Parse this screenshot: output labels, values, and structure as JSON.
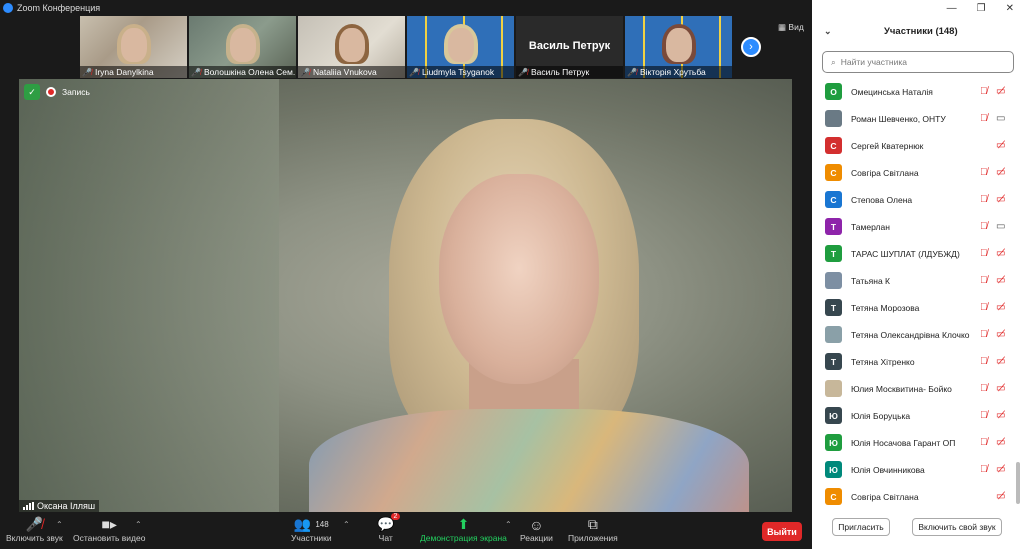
{
  "window": {
    "title": "Zoom Конференция"
  },
  "thumbnails": [
    {
      "name": "Iryna Danylkina",
      "muted": true
    },
    {
      "name": "Волошкіна Олена Сем...",
      "muted": true
    },
    {
      "name": "Nataliia Vnukova",
      "muted": true
    },
    {
      "name": "Liudmyla Tsyganok",
      "muted": true
    },
    {
      "name": "Василь Петрук",
      "muted": true,
      "display_text": "Василь Петрук"
    },
    {
      "name": "Вікторія Хрутьба",
      "muted": true
    }
  ],
  "view_label": "Вид",
  "recording": {
    "label": "Запись"
  },
  "main_video": {
    "speaker_name": "Оксана Ілляш"
  },
  "toolbar": {
    "unmute": "Включить звук",
    "stop_video": "Остановить видео",
    "participants": "Участники",
    "participants_count": "148",
    "chat": "Чат",
    "chat_badge": "2",
    "share": "Демонстрация экрана",
    "reactions": "Реакции",
    "apps": "Приложения",
    "leave": "Выйти"
  },
  "panel": {
    "title": "Участники (148)",
    "search_placeholder": "Найти участника",
    "participants": [
      {
        "initial": "О",
        "name": "Омецинська Наталія",
        "color": "#1f9d3f",
        "cam_on": false
      },
      {
        "initial": "",
        "name": "Роман Шевченко, ОНТУ",
        "color": "#6a7a85",
        "cam_on": true
      },
      {
        "initial": "С",
        "name": "Сергей Кватернюк",
        "color": "#d32f2f",
        "cam_on": false,
        "no_mic": true
      },
      {
        "initial": "С",
        "name": "Совгіра Світлана",
        "color": "#ef8c00",
        "cam_on": false
      },
      {
        "initial": "С",
        "name": "Степова Олена",
        "color": "#1976d2",
        "cam_on": false
      },
      {
        "initial": "Т",
        "name": "Тамерлан",
        "color": "#8e24aa",
        "cam_on": true
      },
      {
        "initial": "Т",
        "name": "ТАРАС ШУПЛАТ (ЛДУБЖД)",
        "color": "#1f9d3f",
        "cam_on": false
      },
      {
        "initial": "",
        "name": "Татьяна К",
        "color": "#7d8fa3",
        "cam_on": false
      },
      {
        "initial": "Т",
        "name": "Тетяна Морозова",
        "color": "#37474f",
        "cam_on": false
      },
      {
        "initial": "",
        "name": "Тетяна Олександрівна Клочко",
        "color": "#8aa0a8",
        "cam_on": false
      },
      {
        "initial": "Т",
        "name": "Тетяна Хітренко",
        "color": "#37474f",
        "cam_on": false
      },
      {
        "initial": "",
        "name": "Юлия Москвитина- Бойко",
        "color": "#c7b79a",
        "cam_on": false
      },
      {
        "initial": "Ю",
        "name": "Юлія Боруцька",
        "color": "#37474f",
        "cam_on": false
      },
      {
        "initial": "Ю",
        "name": "Юлія Носачова Гарант ОП",
        "color": "#1f9d3f",
        "cam_on": false
      },
      {
        "initial": "Ю",
        "name": "Юлія Овчинникова",
        "color": "#00897b",
        "cam_on": false
      },
      {
        "initial": "С",
        "name": "Совгіра Світлана",
        "color": "#ef8c00",
        "cam_on": false,
        "no_mic": true
      }
    ],
    "invite": "Пригласить",
    "unmute_me": "Включить свой звук"
  }
}
